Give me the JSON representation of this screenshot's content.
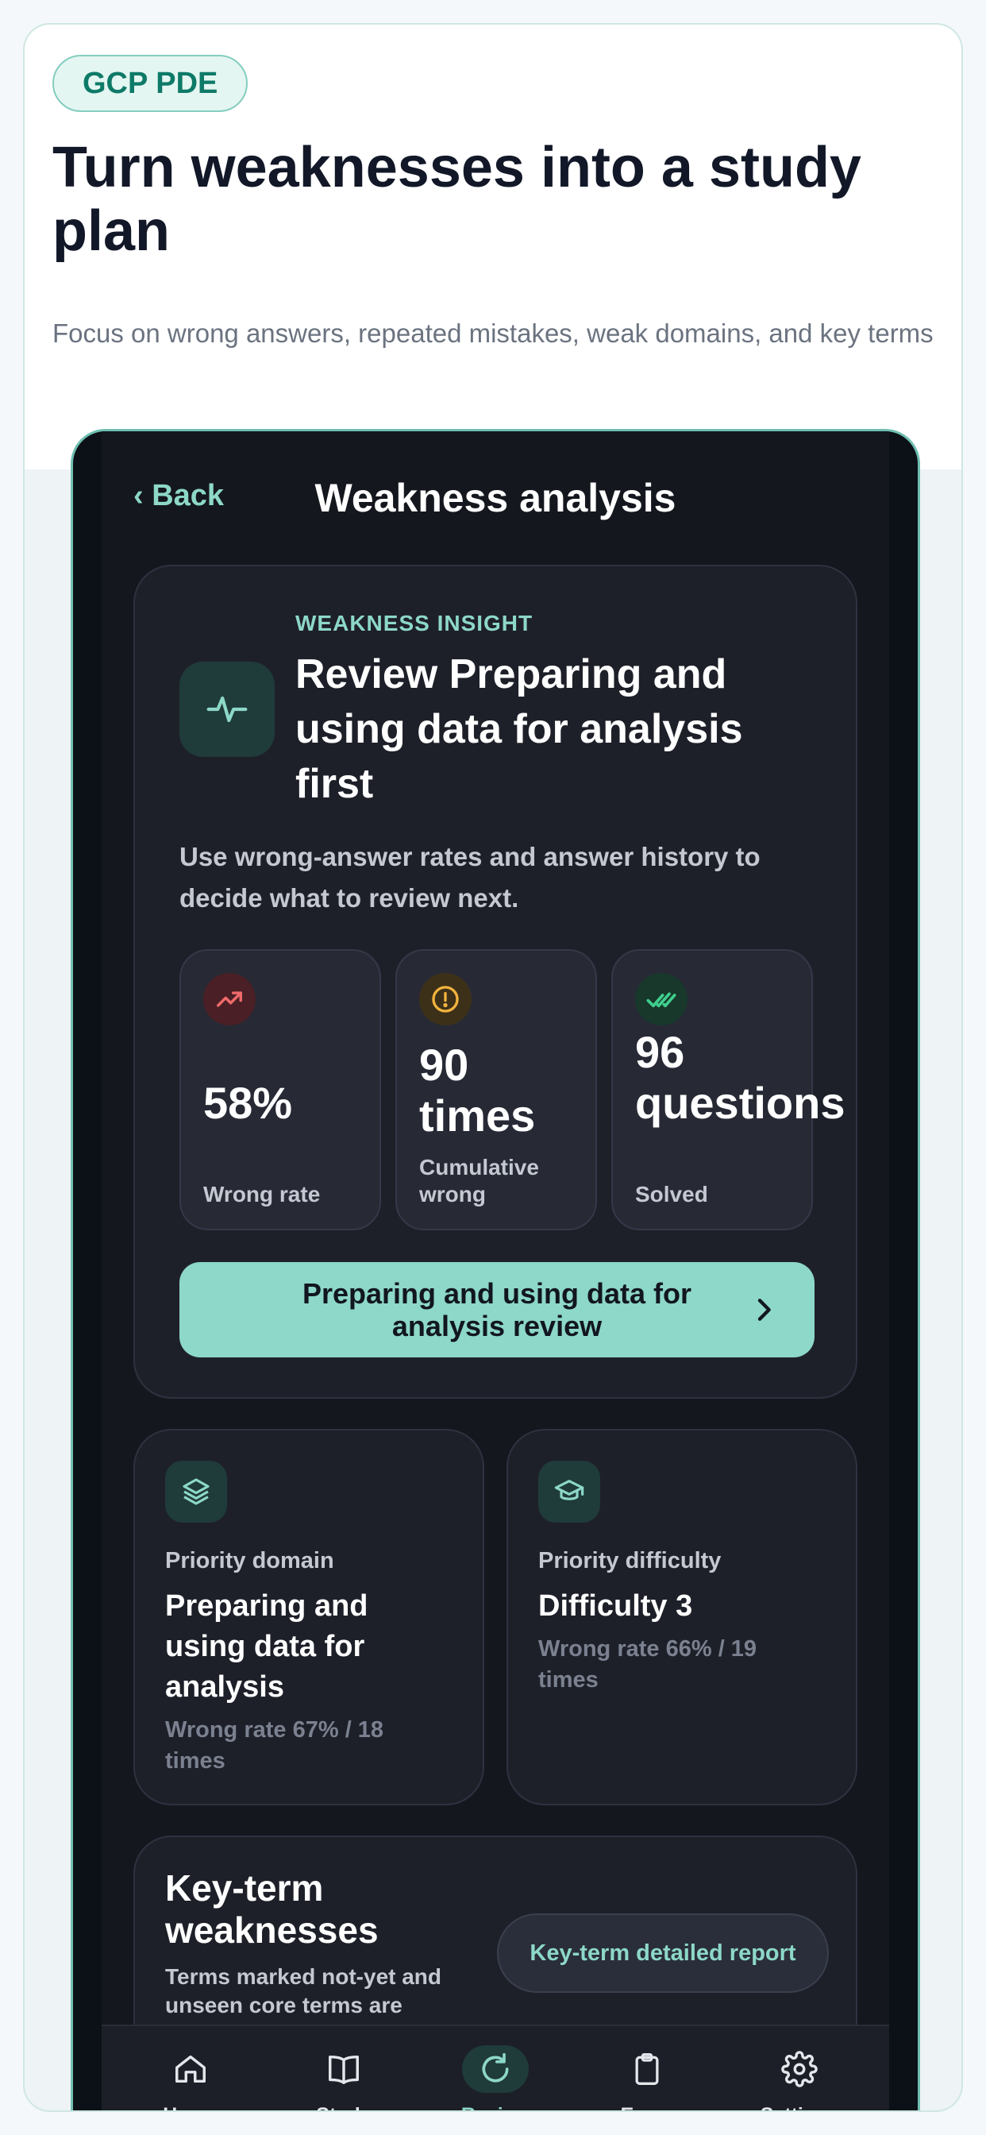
{
  "header": {
    "tag": "GCP PDE",
    "headline": "Turn weaknesses into a study plan",
    "subtitle": "Focus on wrong answers, repeated mistakes, weak domains, and key terms"
  },
  "nav": {
    "back_label": "‹ Back",
    "title": "Weakness analysis"
  },
  "insight": {
    "eyebrow": "WEAKNESS INSIGHT",
    "title": "Review Preparing and using data for analysis first",
    "description": "Use wrong-answer rates and answer history to decide what to review next.",
    "icon": "pulse-icon",
    "stats": [
      {
        "value": "58%",
        "label": "Wrong rate",
        "icon": "trend-up-icon",
        "color": "#f06a6a"
      },
      {
        "value": "90 times",
        "label": "Cumulative wrong",
        "icon": "alert-circle-icon",
        "color": "#f2b33d"
      },
      {
        "value": "96 questions",
        "label": "Solved",
        "icon": "double-check-icon",
        "color": "#3fcf8e"
      }
    ],
    "cta_label": "Preparing and using data for analysis review"
  },
  "priority_domain": {
    "label": "Priority domain",
    "value": "Preparing and using data for analysis",
    "meta": "Wrong rate 67% / 18 times",
    "icon": "layers-icon"
  },
  "priority_difficulty": {
    "label": "Priority difficulty",
    "value": "Difficulty 3",
    "meta": "Wrong rate 66% / 19 times",
    "icon": "graduation-cap-icon"
  },
  "key_terms": {
    "title": "Key-term weaknesses",
    "description": "Terms marked not-yet and unseen core terms are",
    "button_label": "Key-term detailed report"
  },
  "tabs": [
    {
      "label": "Home",
      "icon": "home-icon",
      "active": false
    },
    {
      "label": "Study",
      "icon": "book-icon",
      "active": false
    },
    {
      "label": "Review",
      "icon": "refresh-icon",
      "active": true
    },
    {
      "label": "Exam",
      "icon": "clipboard-icon",
      "active": false
    },
    {
      "label": "Settings",
      "icon": "gear-icon",
      "active": false
    }
  ],
  "colors": {
    "accent": "#8dd8c8",
    "brand_tag": "#0e7a68",
    "danger": "#f06a6a",
    "warning": "#f2b33d",
    "success": "#3fcf8e"
  }
}
